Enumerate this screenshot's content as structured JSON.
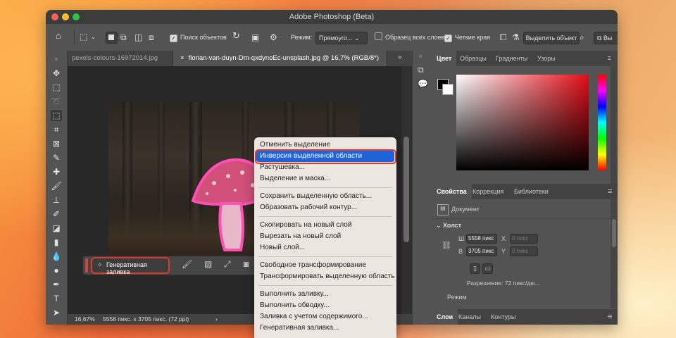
{
  "window": {
    "title": "Adobe Photoshop (Beta)"
  },
  "options_bar": {
    "search_objects_label": "Поиск объектов",
    "mode_label": "Режим:",
    "mode_value": "Прямоуго...",
    "sample_all_layers_label": "Образец всех слоев",
    "hard_edges_label": "Четкие края",
    "select_subject_label": "Выделить объект"
  },
  "tabs": [
    {
      "label": "pexels-colours-16972014.jpg"
    },
    {
      "label": "florian-van-duyn-Dm-qxdynoEc-unsplash.jpg @ 16,7% (RGB/8*)"
    }
  ],
  "status": {
    "zoom": "16,67%",
    "info": "5558 пикс. x 3705 пикс. (72 ppi)"
  },
  "contextual_bar": {
    "generative_fill_label": "Генеративная заливка"
  },
  "context_menu": {
    "items": [
      "Отменить выделение",
      "Инверсия выделенной области",
      "Растушевка...",
      "Выделение и маска...",
      "Сохранить выделенную область...",
      "Образовать рабочий контур...",
      "Скопировать на новый слой",
      "Вырезать на новый слой",
      "Новый слой...",
      "Свободное трансформирование",
      "Трансформировать выделенную область",
      "Выполнить заливку...",
      "Выполнить обводку...",
      "Заливка с учетом содержимого...",
      "Генеративная заливка..."
    ],
    "highlighted_index": 1
  },
  "color_panel": {
    "tabs": [
      "Цвет",
      "Образцы",
      "Градиенты",
      "Узоры"
    ]
  },
  "properties_panel": {
    "tabs": [
      "Свойства",
      "Коррекция",
      "Библиотеки"
    ],
    "type_label": "Документ",
    "section_title": "Холст",
    "w_label": "Ш",
    "w_value": "5558 пикс",
    "h_label": "В",
    "h_value": "3705 пикс",
    "x_label": "X",
    "x_value": "0 пикс",
    "y_label": "Y",
    "y_value": "0 пикс",
    "resolution": "Разрешение: 72 пикс/дю...",
    "mode_label": "Режим"
  },
  "layers_panel": {
    "tabs": [
      "Слои",
      "Каналы",
      "Контуры"
    ]
  },
  "colors": {
    "accent_blue": "#1f63d8",
    "highlight_ring": "#e03a2a",
    "mushroom_pink": "#e0569a"
  }
}
